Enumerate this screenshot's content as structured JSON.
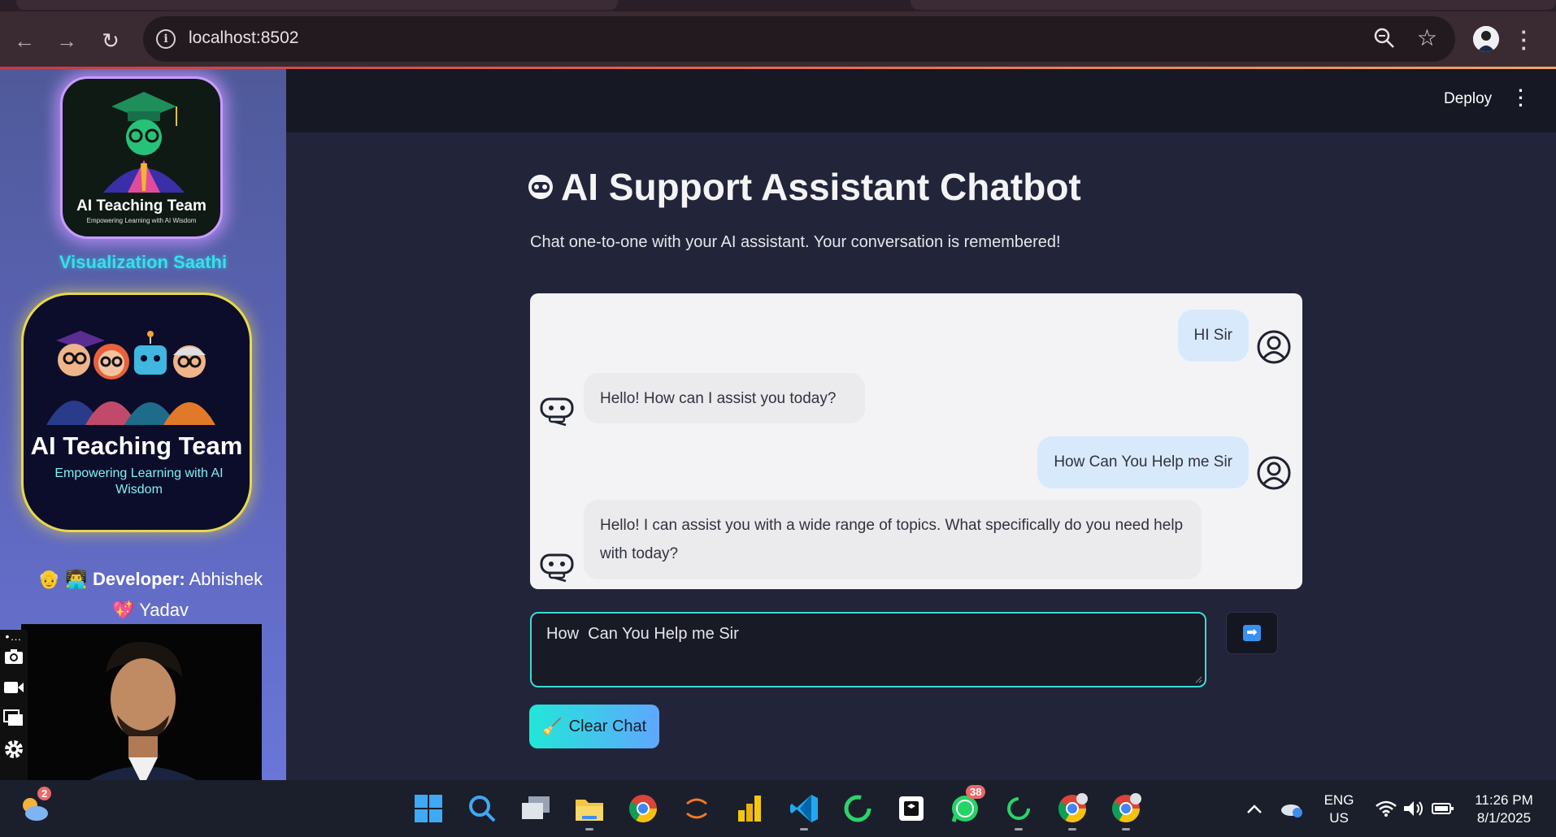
{
  "browser": {
    "url": "localhost:8502",
    "icons": [
      "back-arrow-icon",
      "forward-arrow-icon",
      "reload-icon",
      "site-info-icon",
      "zoom-icon",
      "bookmark-star-icon",
      "profile-avatar",
      "browser-menu-icon"
    ]
  },
  "sidebar": {
    "logo1": {
      "title": "AI Teaching Team",
      "subtitle": "Empowering Learning with AI Wisdom"
    },
    "brand": "Visualization Saathi",
    "logo2": {
      "title": "AI Teaching Team",
      "subtitle": "Empowering Learning with AI Wisdom"
    },
    "developer": {
      "emojis": "👴 👨‍💻",
      "label": "Developer:",
      "name_first": "Abhishek",
      "heart": "💖",
      "name_last": "Yadav"
    }
  },
  "header": {
    "deploy_label": "Deploy"
  },
  "page": {
    "title": "AI Support Assistant Chatbot",
    "description": "Chat one-to-one with your AI assistant. Your conversation is remembered!"
  },
  "chat": {
    "messages": [
      {
        "role": "user",
        "text": "HI Sir"
      },
      {
        "role": "assistant",
        "text": "Hello! How can I assist you today?"
      },
      {
        "role": "user",
        "text": "How Can You Help me Sir"
      },
      {
        "role": "assistant",
        "text": "Hello! I can assist you with a wide range of topics. What specifically do you need help with today?"
      }
    ]
  },
  "input": {
    "value": "How  Can You Help me Sir"
  },
  "clear_button": {
    "icon": "🧹",
    "label": "Clear Chat"
  },
  "taskbar": {
    "weather_badge": "2",
    "whatsapp_badge": "38",
    "lang_top": "ENG",
    "lang_bottom": "US",
    "time": "11:26 PM",
    "date": "8/1/2025"
  },
  "colors": {
    "accent_cyan": "#3fd9d3",
    "sidebar_top": "#4f5a9a",
    "sidebar_bottom": "#6a76d8",
    "user_bubble": "#d9e9fc",
    "bot_bubble": "#ebebed"
  }
}
